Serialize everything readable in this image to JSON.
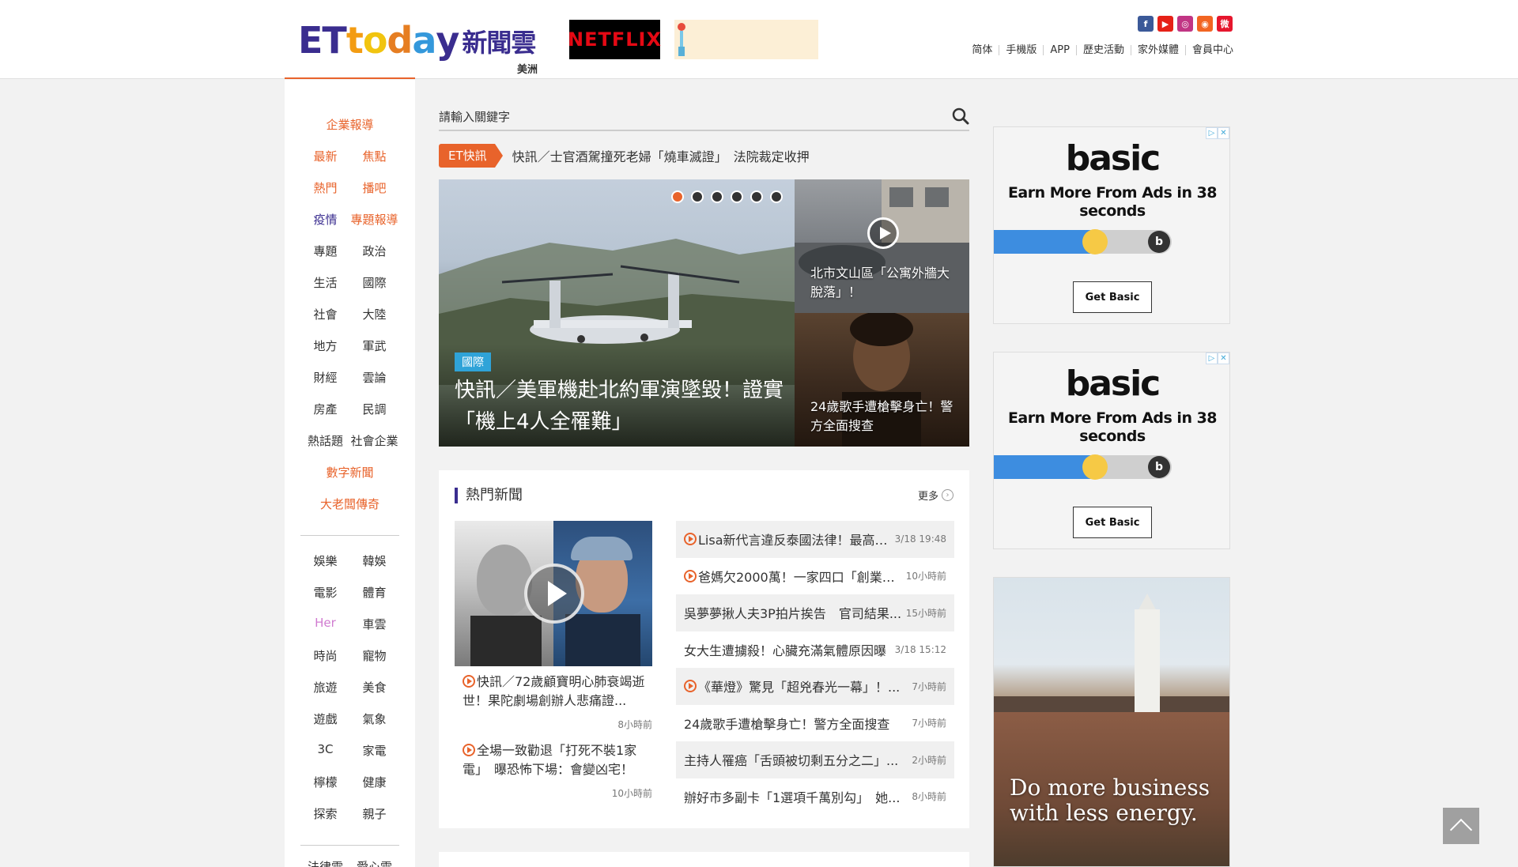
{
  "header": {
    "logo_et": "ET",
    "logo_t": "t",
    "logo_o": "o",
    "logo_d": "d",
    "logo_a": "a",
    "logo_y": "y",
    "logo_cloud": "新聞雲",
    "region": "美洲",
    "netflix": "NETFLIX",
    "social": [
      "f",
      "▶",
      "◎",
      "◉",
      "微"
    ],
    "nav": [
      "简体",
      "手機版",
      "APP",
      "歷史活動",
      "家外媒體",
      "會員中心"
    ]
  },
  "sidebar": {
    "group1": [
      [
        "企業報導"
      ],
      [
        "最新",
        "焦點"
      ],
      [
        "熱門",
        "播吧"
      ],
      [
        "疫情",
        "專題報導"
      ],
      [
        "專題",
        "政治"
      ],
      [
        "生活",
        "國際"
      ],
      [
        "社會",
        "大陸"
      ],
      [
        "地方",
        "軍武"
      ],
      [
        "財經",
        "雲論"
      ],
      [
        "房產",
        "民調"
      ],
      [
        "熱話題",
        "社會企業"
      ],
      [
        "數字新聞"
      ],
      [
        "大老闆傳奇"
      ]
    ],
    "group2": [
      [
        "娛樂",
        "韓娛"
      ],
      [
        "電影",
        "體育"
      ],
      [
        "Her",
        "車雲"
      ],
      [
        "時尚",
        "寵物"
      ],
      [
        "旅遊",
        "美食"
      ],
      [
        "遊戲",
        "氣象"
      ],
      [
        "3C",
        "家電"
      ],
      [
        "檸檬",
        "健康"
      ],
      [
        "探索",
        "親子"
      ],
      [
        "法律雲",
        "愛心雲"
      ]
    ]
  },
  "search": {
    "placeholder": "請輸入關鍵字"
  },
  "flash": {
    "tag": "ET快訊",
    "text": "快訊／士官酒駕撞死老婦「燒車滅證」　法院裁定收押"
  },
  "hero": {
    "category": "國際",
    "title": "快訊／美軍機赴北約軍演墜毀！證實「機上4人全罹難」",
    "dots": 6,
    "active_dot": 0
  },
  "side_news": [
    {
      "caption": "北市文山區「公寓外牆大脫落」！"
    },
    {
      "caption": "24歲歌手遭槍擊身亡！警方全面搜查"
    }
  ],
  "hot": {
    "title": "熱門新聞",
    "more": "更多",
    "featured": [
      {
        "text": "快訊／72歲顧寶明心肺衰竭逝世！果陀劇場創辦人悲痛證...",
        "time": "8小時前",
        "video": true
      },
      {
        "text": "全場一致勸退「打死不裝1家電」　曝恐怖下場：會變凶宅！",
        "time": "10小時前",
        "video": true
      }
    ],
    "list": [
      {
        "text": "Lisa新代言違反泰國法律！最高「...",
        "time": "3/18 19:48",
        "video": true
      },
      {
        "text": "爸媽欠2000萬！一家四口「創業賣...",
        "time": "10小時前",
        "video": true
      },
      {
        "text": "吳夢夢揪人夫3P拍片挨告　官司結果...",
        "time": "15小時前",
        "video": false
      },
      {
        "text": "女大生遭擄殺！心臟充滿氣體原因曝",
        "time": "3/18 15:12",
        "video": false
      },
      {
        "text": "《華燈》驚見「超兇春光一幕」！...",
        "time": "7小時前",
        "video": true
      },
      {
        "text": "24歲歌手遭槍擊身亡！警方全面搜查",
        "time": "7小時前",
        "video": false
      },
      {
        "text": "主持人罹癌「舌頭被切剩五分之二」...",
        "time": "2小時前",
        "video": false
      },
      {
        "text": "辦好市多副卡「1選項千萬別勾」　她...",
        "time": "8小時前",
        "video": false
      }
    ]
  },
  "ads": {
    "logo": "basic",
    "text": "Earn More From Ads in 38 seconds",
    "button": "Get Basic",
    "slider_level": 0.57,
    "badge_info": "▷",
    "badge_close": "✕",
    "slogan": "Do more business with less energy."
  },
  "colors": {
    "accent": "#e8632b",
    "brand": "#3a2d8f",
    "tag_blue": "#2fa3d8"
  }
}
